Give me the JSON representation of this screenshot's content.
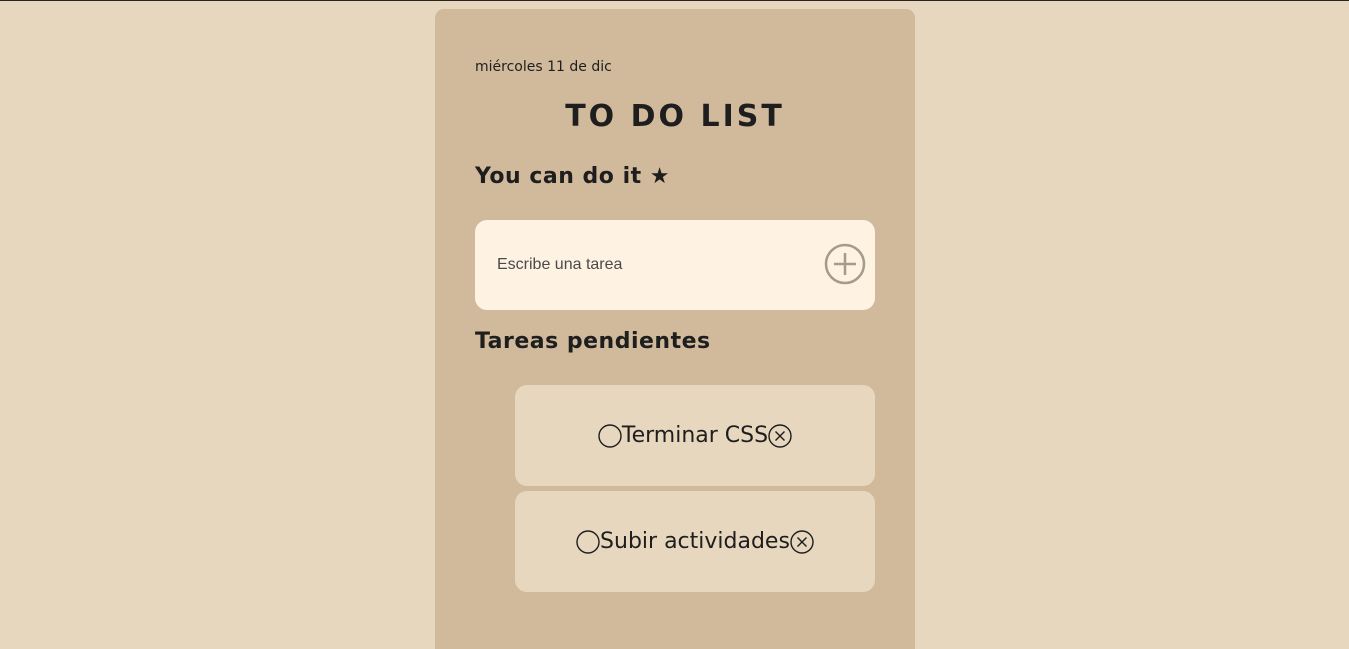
{
  "header": {
    "date": "miércoles 11 de dic",
    "title": "TO DO LIST",
    "motto": "You can do it ★"
  },
  "new_task": {
    "placeholder": "Escribe una tarea",
    "value": "",
    "add_icon": "plus-circle-icon"
  },
  "pending": {
    "heading": "Tareas pendientes",
    "tasks": [
      {
        "text": "Terminar CSS",
        "status_icon": "empty-circle-icon",
        "delete_icon": "circle-x-icon"
      },
      {
        "text": "Subir actividades",
        "status_icon": "empty-circle-icon",
        "delete_icon": "circle-x-icon"
      }
    ]
  },
  "colors": {
    "page_background": "#e8d7bf",
    "card_background": "#d1b99c",
    "input_background": "#fef2e2",
    "task_background": "#e8d7bf",
    "text": "#1e1e1e",
    "add_icon": "#a39c8a"
  }
}
